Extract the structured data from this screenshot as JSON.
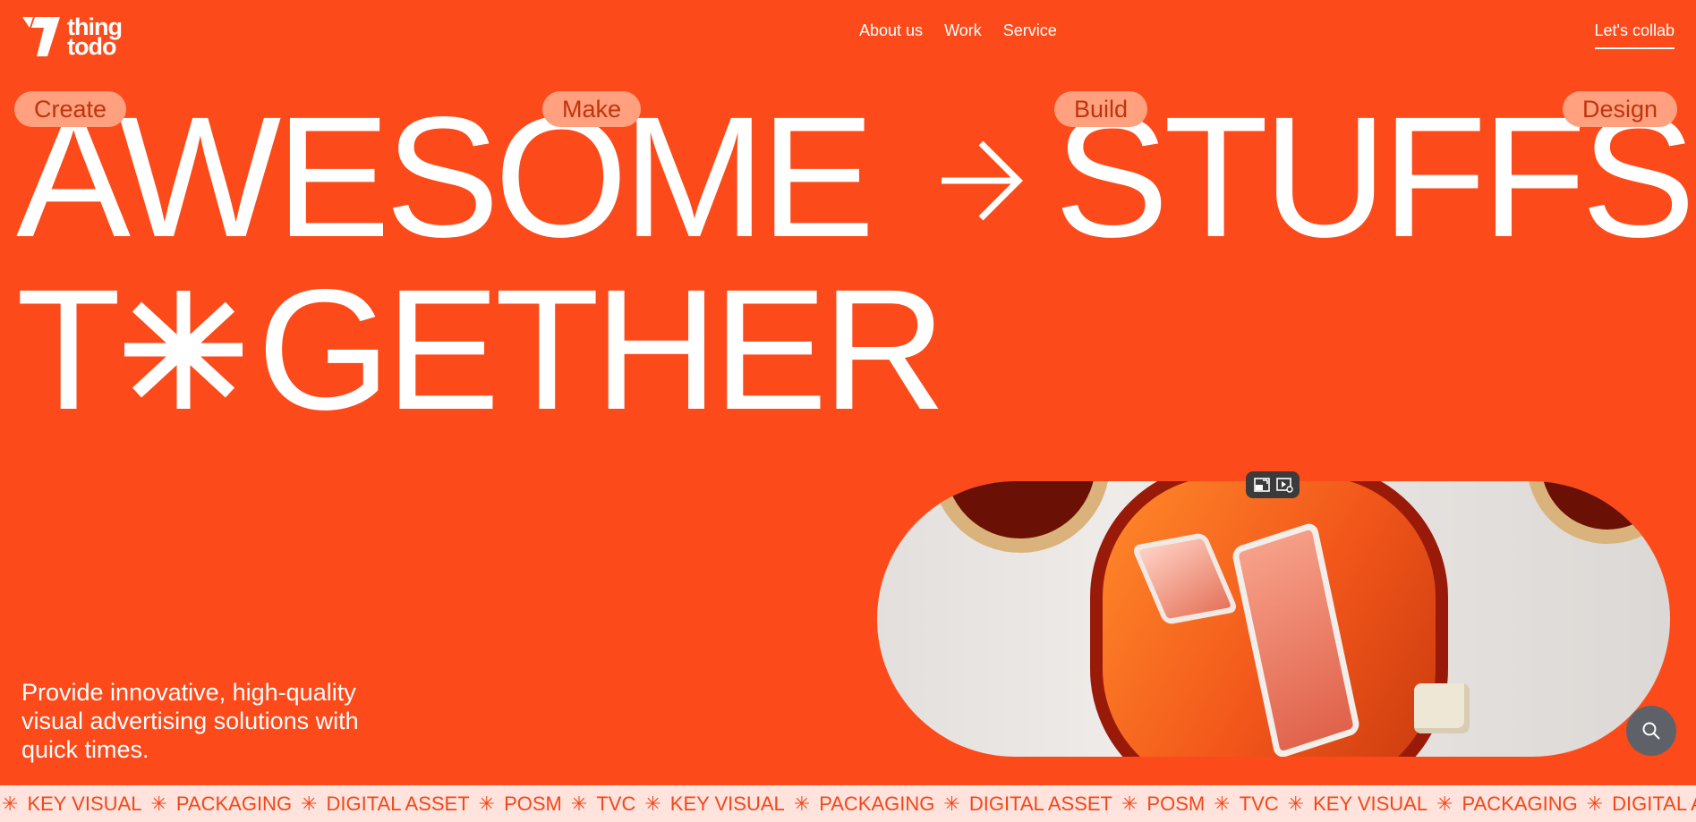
{
  "brand": {
    "logo_line1": "thing",
    "logo_line2": "todo"
  },
  "nav": {
    "items": [
      "About us",
      "Work",
      "Service"
    ],
    "cta": "Let's collab"
  },
  "hero": {
    "line1_left": "AWESOME",
    "line1_right": "STUFFS",
    "line2_start": "T",
    "line2_end": "GETHER",
    "pills": [
      "Create",
      "Make",
      "Build",
      "Design"
    ],
    "tagline": "Provide innovative, high-quality visual advertising solutions with quick times."
  },
  "marquee": {
    "items": [
      "KEY VISUAL",
      "PACKAGING",
      "DIGITAL ASSET",
      "POSM",
      "TVC",
      "KEY VISUAL",
      "PACKAGING",
      "DIGITAL ASSET",
      "POSM",
      "TVC",
      "KEY VISUAL",
      "PACKAGING",
      "DIGITAL ASSET"
    ]
  },
  "icons": {
    "arrow": "arrow-right-icon",
    "asterisk": "asterisk-icon",
    "search": "search-icon",
    "pip": [
      "picture-in-picture-icon",
      "video-settings-icon"
    ]
  },
  "colors": {
    "background": "#fc4a1a",
    "pill": "#ffa07e",
    "pill_text": "#c0340d",
    "marquee_bg": "#ffe3dc",
    "marquee_text": "#f2471a"
  }
}
